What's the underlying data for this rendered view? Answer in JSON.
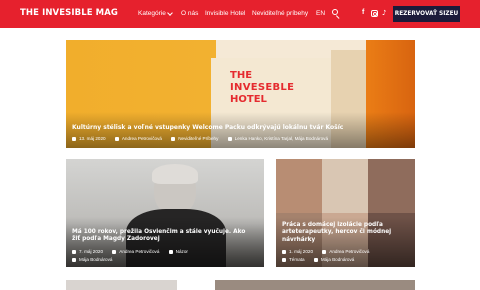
{
  "header": {
    "logo": "THE INVESIBLE MAG",
    "nav": [
      "Kategórie",
      "O nás",
      "Invisible Hotel",
      "Neviditeľné príbehy",
      "EN"
    ],
    "social": [
      "f",
      "♪"
    ],
    "cta": "REZERVOVAŤ SIZEU"
  },
  "hero": {
    "poster_line1": "THE",
    "poster_line2": "INVESEBLE",
    "poster_line3": "HOTEL",
    "title": "Kultúrny stélisk a voľné vstupenky Welcome Packu odkrývajú lokálnu tvár Košíc",
    "date": "13. máj 2020",
    "author": "Andrea Petrovičová",
    "category": "Neviditeľné Príbehy",
    "tags": "Lenka Hanko, Kristína Tarjal, Mája Bodnárová"
  },
  "card_left": {
    "title": "Má 100 rokov, prežila Osvienčim a stále vyučuje. Ako žiť podľa Magdy Zadorovej",
    "date": "7. máj 2020",
    "author": "Andrea Petrovičová",
    "category": "Názor",
    "tags": "Mája Bodnárová"
  },
  "card_right": {
    "title": "Práca s domácej izolácie podľa arteterapeutky, hercov či módnej návrhárky",
    "date": "1. máj 2020",
    "author": "Andrea Petrovičová",
    "category": "Témata",
    "tags": "Mája Bodnárová"
  }
}
